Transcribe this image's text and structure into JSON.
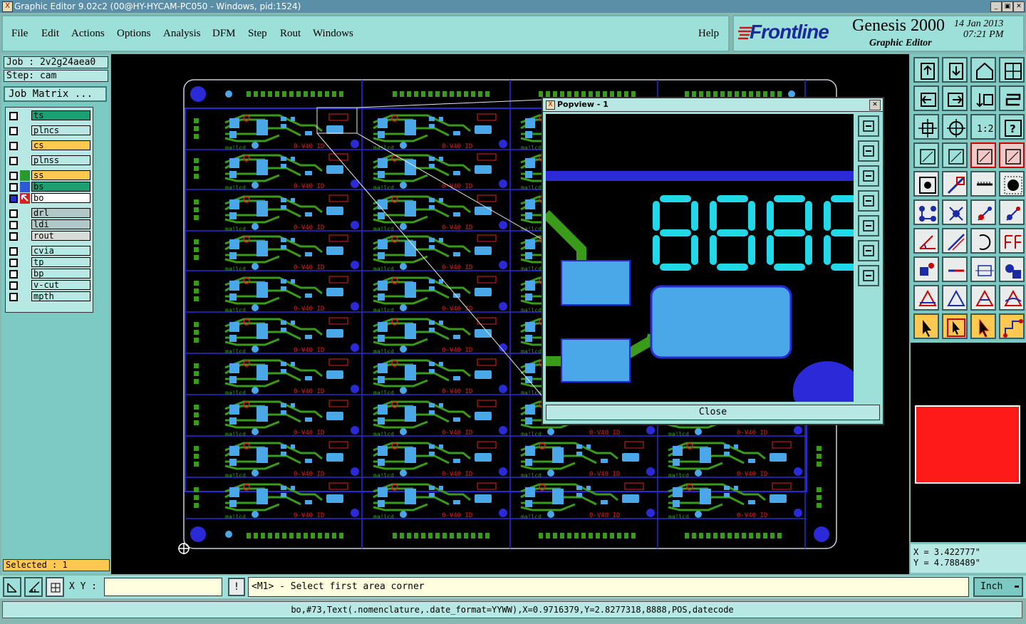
{
  "window": {
    "title": "Graphic Editor 9.02c2 (00@HY-HYCAM-PC050 - Windows, pid:1524)",
    "app_icon_glyph": "X",
    "btn_minimize": "_",
    "btn_restore": "▣",
    "btn_close": "✕"
  },
  "menubar": {
    "items": [
      "File",
      "Edit",
      "Actions",
      "Options",
      "Analysis",
      "DFM",
      "Step",
      "Rout",
      "Windows"
    ],
    "help": "Help"
  },
  "brand": {
    "logo_text": "Frontline",
    "product": "Genesis 2000",
    "subtitle": "Graphic Editor",
    "date": "14 Jan 2013",
    "time": "07:21 PM"
  },
  "job": {
    "job_line": "Job : 2v2g24aea0",
    "step_line": "Step: cam",
    "job_matrix_label": "Job Matrix ..."
  },
  "layers": [
    {
      "name": "ts",
      "color": "#1a9e72"
    },
    {
      "name": "plncs",
      "color": "#b8e8e3"
    },
    {
      "name": "cs",
      "color": "#ffc850"
    },
    {
      "name": "plnss",
      "color": "#b8e8e3"
    },
    {
      "name": "ss",
      "color": "#ffc850"
    },
    {
      "name": "bs",
      "color": "#1a9e72"
    },
    {
      "name": "bo",
      "color": "#ffffff"
    },
    {
      "name": "drl",
      "color": "#b0c8c8"
    },
    {
      "name": "ldi",
      "color": "#b0c8c8"
    },
    {
      "name": "rout",
      "color": "#d8dcd8"
    },
    {
      "name": "cvia",
      "color": "#b8e8e3"
    },
    {
      "name": "tp",
      "color": "#b8e8e3"
    },
    {
      "name": "bp",
      "color": "#b8e8e3"
    },
    {
      "name": "v-cut",
      "color": "#b8e8e3"
    },
    {
      "name": "mpth",
      "color": "#b8e8e3"
    }
  ],
  "selected": "Selected : 1",
  "board": {
    "pcb_text": "0-V40 ID",
    "silk_text": "ma!lcd",
    "digits": "8888",
    "colors": {
      "bg": "#000000",
      "outline": "#2a2ad8",
      "pad": "#4aa8e8",
      "trace": "#3a9a1a",
      "label": "#e02020",
      "digit": "#20d8e8"
    }
  },
  "popview": {
    "title": "Popview - 1",
    "close_label": "Close",
    "title_icon_glyph": "X",
    "close_glyph": "✕"
  },
  "coords": {
    "x": "X = 3.422777\"",
    "y": "Y = 4.788489\""
  },
  "cmdbar": {
    "xy_label": "X Y :",
    "xy_value": "",
    "info_glyph": "!",
    "prompt": "<M1> - Select first area corner",
    "units": "Inch"
  },
  "status": "bo,#73,Text(.nomenclature,.date_format=YYWW),X=0.9716379,Y=2.8277318,8888,POS,datecode",
  "colorwell": {
    "color": "#ff1a1a"
  }
}
